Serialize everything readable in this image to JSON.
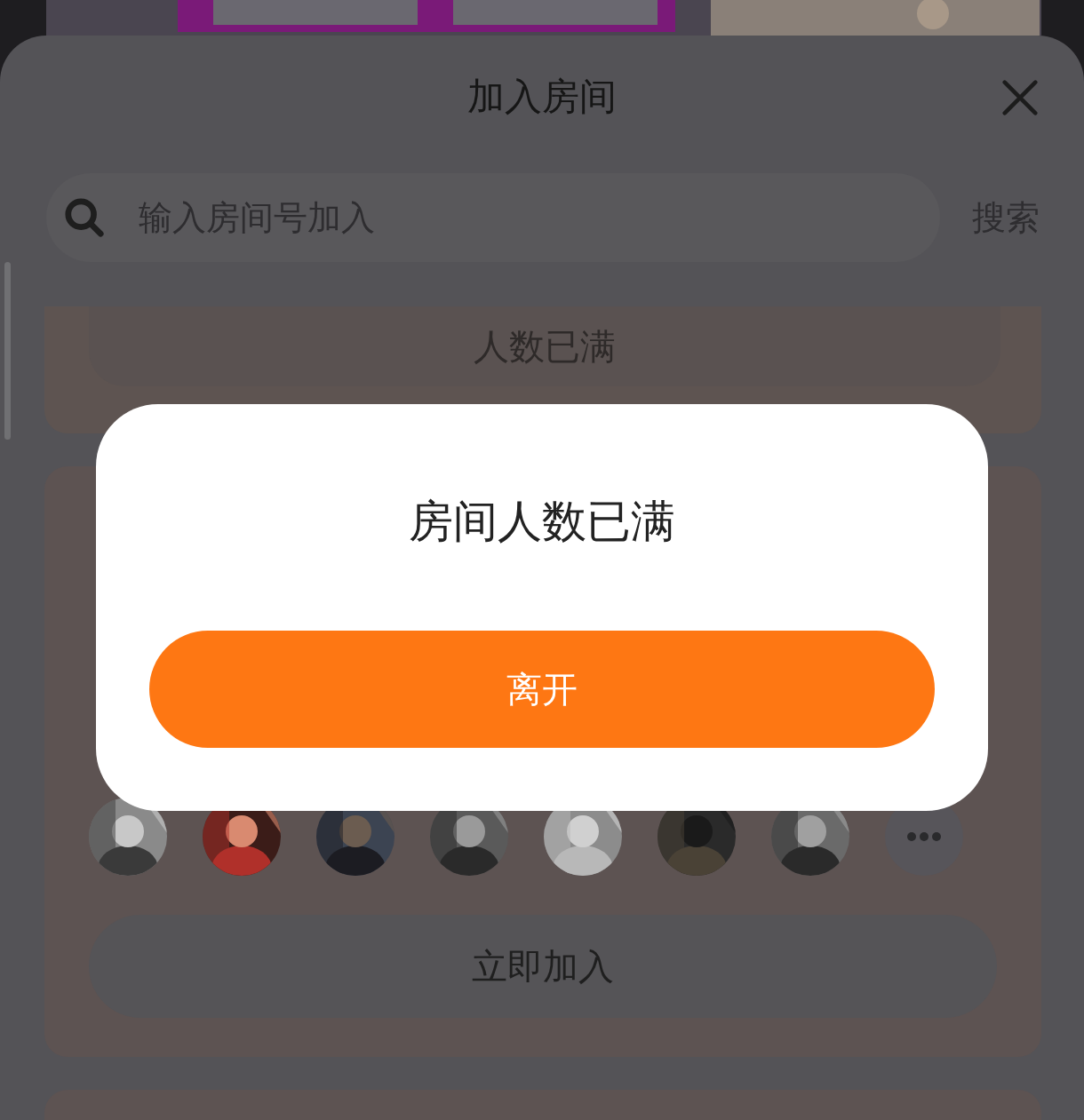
{
  "sheet": {
    "title": "加入房间"
  },
  "search": {
    "placeholder": "输入房间号加入",
    "button": "搜索"
  },
  "rooms": [
    {
      "kind": "full",
      "button": "人数已满"
    },
    {
      "kind": "open",
      "button": "立即加入"
    },
    {
      "kind": "partial"
    }
  ],
  "dialog": {
    "message": "房间人数已满",
    "button": "离开"
  }
}
